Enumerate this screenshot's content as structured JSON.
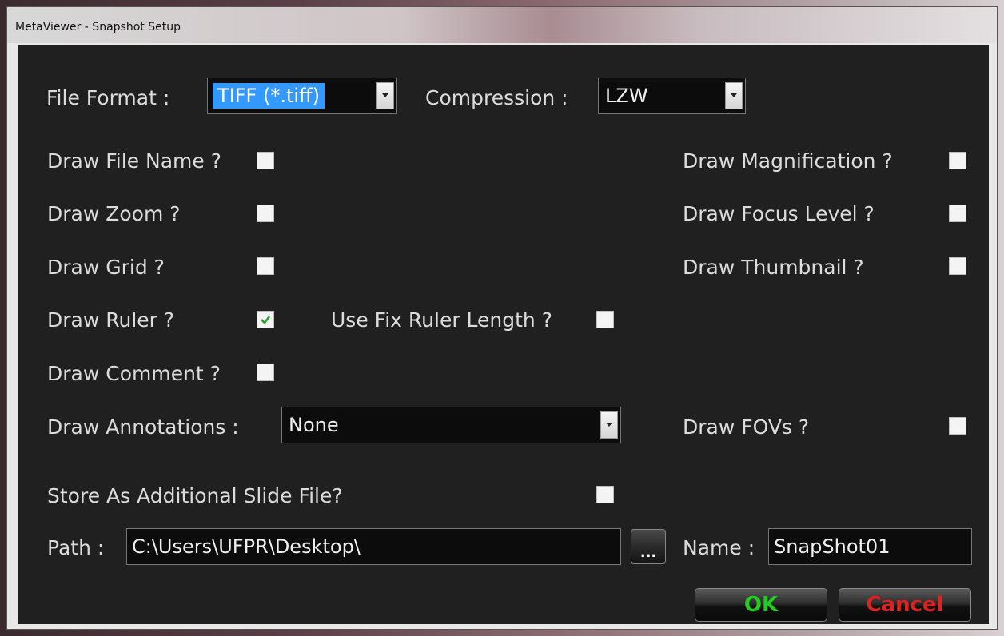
{
  "window": {
    "title": "MetaViewer - Snapshot Setup"
  },
  "file_format": {
    "label": "File Format :",
    "value": "TIFF (*.tiff)"
  },
  "compression": {
    "label": "Compression :",
    "value": "LZW"
  },
  "options": {
    "draw_file_name": {
      "label": "Draw File Name ?",
      "checked": false
    },
    "draw_zoom": {
      "label": "Draw Zoom ?",
      "checked": false
    },
    "draw_grid": {
      "label": "Draw Grid ?",
      "checked": false
    },
    "draw_ruler": {
      "label": "Draw Ruler ?",
      "checked": true
    },
    "use_fix_ruler_length": {
      "label": "Use Fix Ruler Length ?",
      "checked": false
    },
    "draw_comment": {
      "label": "Draw Comment ?",
      "checked": false
    },
    "draw_magnification": {
      "label": "Draw Magnification ?",
      "checked": false
    },
    "draw_focus_level": {
      "label": "Draw Focus Level ?",
      "checked": false
    },
    "draw_thumbnail": {
      "label": "Draw Thumbnail ?",
      "checked": false
    },
    "draw_fovs": {
      "label": "Draw FOVs ?",
      "checked": false
    },
    "store_additional": {
      "label": "Store As Additional Slide File?",
      "checked": false
    }
  },
  "annotations": {
    "label": "Draw Annotations :",
    "value": "None"
  },
  "path": {
    "label": "Path :",
    "value": "C:\\Users\\UFPR\\Desktop\\"
  },
  "browse": {
    "label": "..."
  },
  "name": {
    "label": "Name :",
    "value": "SnapShot01"
  },
  "buttons": {
    "ok": "OK",
    "cancel": "Cancel"
  },
  "colors": {
    "ok_text": "#22cc22",
    "cancel_text": "#dd2222",
    "check": "#2aa02a",
    "selection": "#3399ff"
  }
}
